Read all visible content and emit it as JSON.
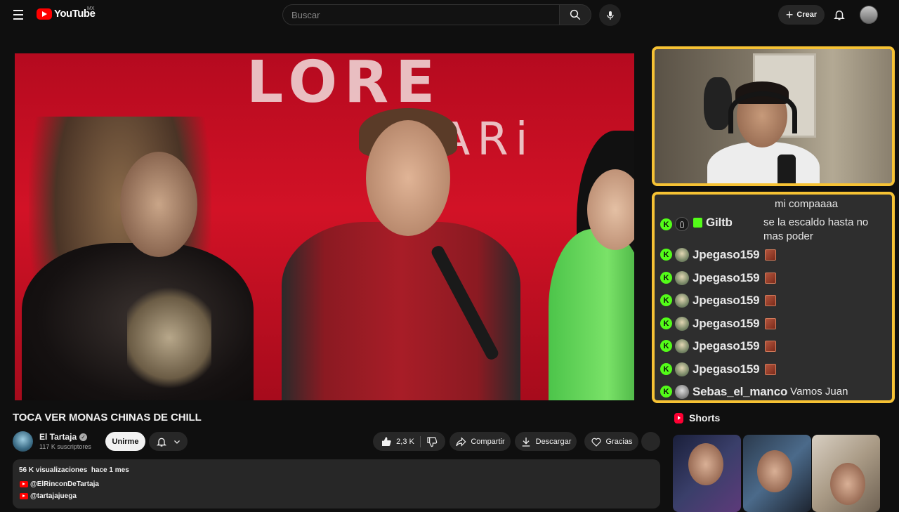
{
  "header": {
    "logo_text": "YouTube",
    "region": "MX",
    "search_placeholder": "Buscar",
    "create_label": "Crear"
  },
  "player": {
    "brand_text": "LORE",
    "brand_sub": "PARi"
  },
  "chat": {
    "messages": [
      {
        "user": "",
        "text": "mi compaaaa"
      },
      {
        "user": "Giltb",
        "text": "se la escaldo hasta no mas poder"
      },
      {
        "user": "Jpegaso159",
        "text": ""
      },
      {
        "user": "Jpegaso159",
        "text": ""
      },
      {
        "user": "Jpegaso159",
        "text": ""
      },
      {
        "user": "Jpegaso159",
        "text": ""
      },
      {
        "user": "Jpegaso159",
        "text": ""
      },
      {
        "user": "Jpegaso159",
        "text": ""
      },
      {
        "user": "Sebas_el_manco",
        "text": "Vamos Juan"
      }
    ],
    "badge_letter": "K"
  },
  "video": {
    "title": "TOCA VER MONAS CHINAS DE CHILL",
    "channel_name": "El Tartaja",
    "subscribers": "117 K suscriptores",
    "join_label": "Unirme",
    "likes": "2,3 K",
    "share_label": "Compartir",
    "download_label": "Descargar",
    "thanks_label": "Gracias"
  },
  "description": {
    "stats": "56 K visualizaciones  hace 1 mes",
    "links": [
      "@ElRinconDeTartaja",
      "@tartajajuega"
    ]
  },
  "shorts": {
    "title": "Shorts"
  },
  "colors": {
    "accent_border": "#f6c234",
    "kick_green": "#53fc18",
    "youtube_red": "#ff0000"
  }
}
